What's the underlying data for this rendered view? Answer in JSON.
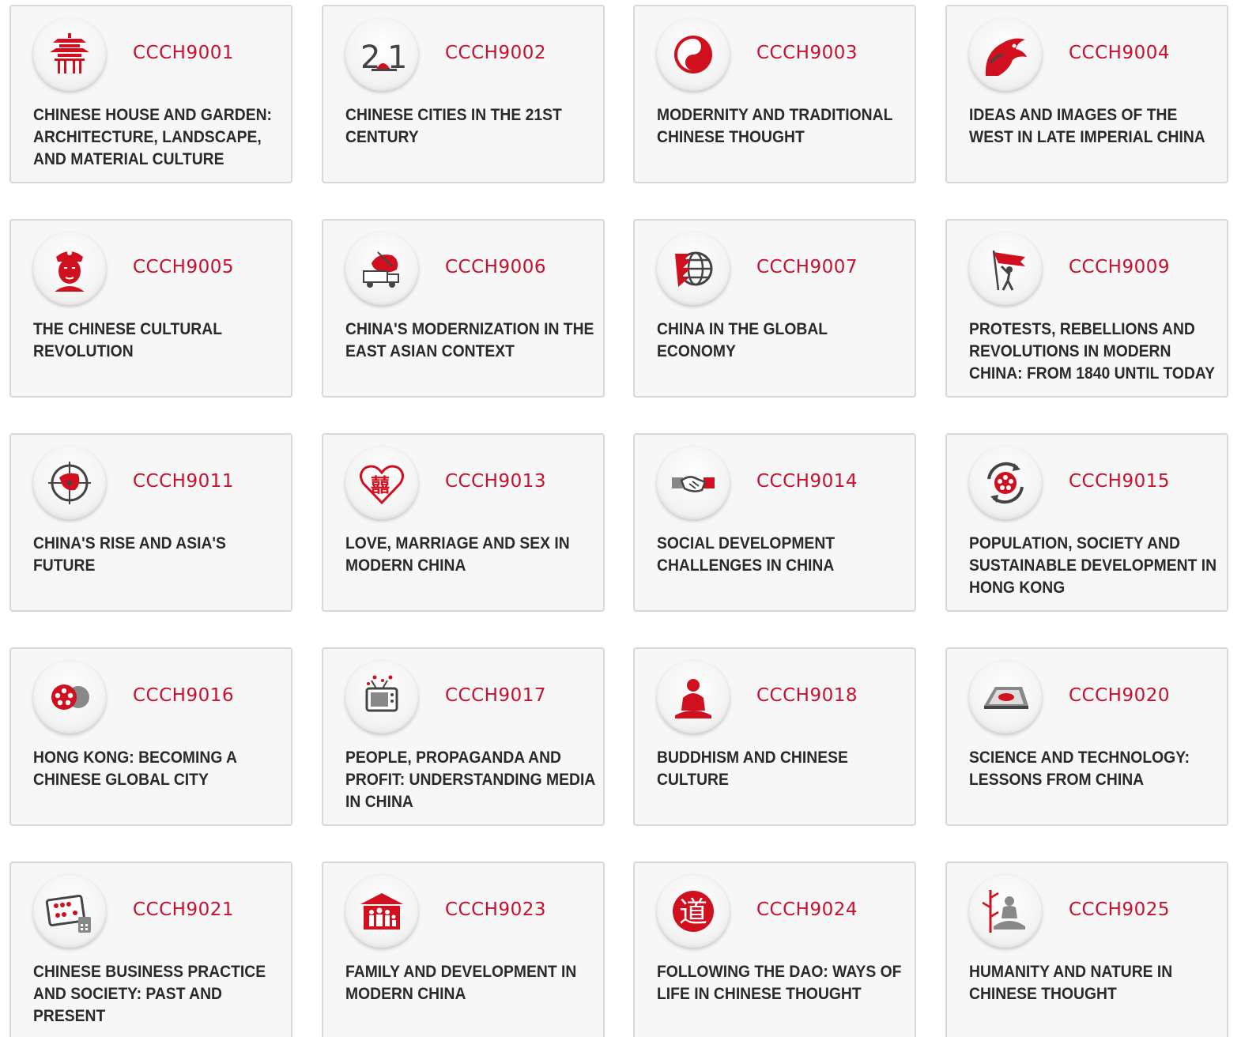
{
  "colors": {
    "accent": "#c8102e",
    "title_text": "#2a2a2a",
    "card_background": "#f7f7f7",
    "card_border": "#d8d8d8"
  },
  "courses": [
    {
      "code": "CCCH9001",
      "title": "Chinese House and Garden: Architecture, Landscape, and Material Culture",
      "icon": "pagoda-icon"
    },
    {
      "code": "CCCH9002",
      "title": "Chinese Cities in the 21st Century",
      "icon": "city-21-icon"
    },
    {
      "code": "CCCH9003",
      "title": "Modernity and Traditional Chinese Thought",
      "icon": "yin-yang-icon"
    },
    {
      "code": "CCCH9004",
      "title": "Ideas and Images of the West in Late Imperial China",
      "icon": "dragon-icon"
    },
    {
      "code": "CCCH9005",
      "title": "The Chinese Cultural Revolution",
      "icon": "portrait-icon"
    },
    {
      "code": "CCCH9006",
      "title": "China's Modernization in the East Asian Context",
      "icon": "map-truck-icon"
    },
    {
      "code": "CCCH9007",
      "title": "China in the Global Economy",
      "icon": "globe-icon"
    },
    {
      "code": "CCCH9009",
      "title": "Protests, Rebellions and Revolutions in Modern China: From 1840 until Today",
      "icon": "flag-bearer-icon"
    },
    {
      "code": "CCCH9011",
      "title": "China's Rise and Asia's Future",
      "icon": "compass-icon"
    },
    {
      "code": "CCCH9013",
      "title": "Love, Marriage and Sex in Modern China",
      "icon": "double-happiness-heart-icon"
    },
    {
      "code": "CCCH9014",
      "title": "Social Development Challenges in China",
      "icon": "handshake-icon"
    },
    {
      "code": "CCCH9015",
      "title": "Population, Society and Sustainable Development in Hong Kong",
      "icon": "bauhinia-cycle-icon"
    },
    {
      "code": "CCCH9016",
      "title": "Hong Kong: Becoming a Chinese Global City",
      "icon": "bauhinia-globe-icon"
    },
    {
      "code": "CCCH9017",
      "title": "People, Propaganda and Profit: Understanding Media in China",
      "icon": "television-icon"
    },
    {
      "code": "CCCH9018",
      "title": "Buddhism and Chinese Culture",
      "icon": "buddha-icon"
    },
    {
      "code": "CCCH9020",
      "title": "Science and Technology: Lessons from China",
      "icon": "compass-board-icon"
    },
    {
      "code": "CCCH9021",
      "title": "Chinese Business Practice and Society: Past and Present",
      "icon": "abacus-icon"
    },
    {
      "code": "CCCH9023",
      "title": "Family and Development in Modern China",
      "icon": "family-house-icon"
    },
    {
      "code": "CCCH9024",
      "title": "Following the Dao: Ways of Life in Chinese Thought",
      "icon": "dao-character-icon"
    },
    {
      "code": "CCCH9025",
      "title": "Humanity and Nature in Chinese Thought",
      "icon": "meditation-bamboo-icon"
    }
  ]
}
